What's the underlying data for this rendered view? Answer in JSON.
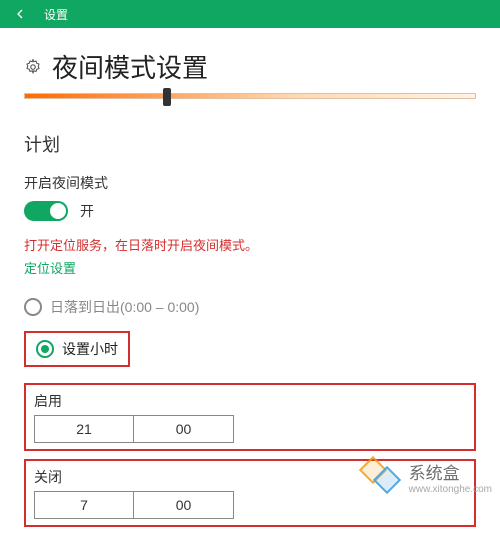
{
  "titlebar": {
    "title": "设置"
  },
  "page": {
    "title": "夜间模式设置"
  },
  "section": {
    "plan": "计划"
  },
  "toggle": {
    "label": "开启夜间模式",
    "state": "开"
  },
  "warning": "打开定位服务，在日落时开启夜间模式。",
  "location_link": "定位设置",
  "radios": {
    "sunset": "日落到日出(0:00 – 0:00)",
    "hours": "设置小时"
  },
  "time": {
    "enable_label": "启用",
    "enable_hour": "21",
    "enable_min": "00",
    "disable_label": "关闭",
    "disable_hour": "7",
    "disable_min": "00"
  },
  "watermark": {
    "text": "系统盒",
    "url": "www.xitonghe.com"
  }
}
